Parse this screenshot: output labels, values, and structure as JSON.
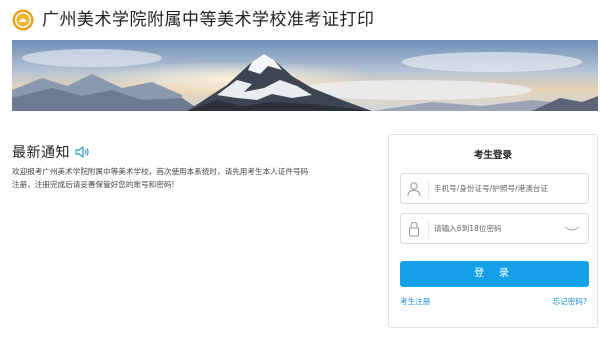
{
  "header": {
    "title": "广州美术学院附属中等美术学校准考证打印",
    "logo_icon": "school-emblem-icon",
    "logo_color": "#e8a21c"
  },
  "banner": {
    "image_icon": "mountain-landscape-banner"
  },
  "notice": {
    "title": "最新通知",
    "icon": "speaker-icon",
    "body": "欢迎报考广州美术学院附属中等美术学校，首次使用本系统时，请先用考生本人证件号码\n注册，注册完成后请妥善保管好您的账号和密码!"
  },
  "login": {
    "title": "考生登录",
    "username": {
      "placeholder": "手机号/身份证号/护照号/港澳台证",
      "icon": "user-icon"
    },
    "password": {
      "placeholder": "请输入6到18位密码",
      "icon": "lock-icon",
      "toggle_icon": "eye-closed-icon"
    },
    "submit_label": "登 录",
    "register_label": "考生注册",
    "forgot_label": "忘记密码?",
    "accent_color": "#14a0e6",
    "link_color": "#1a8fd8"
  }
}
